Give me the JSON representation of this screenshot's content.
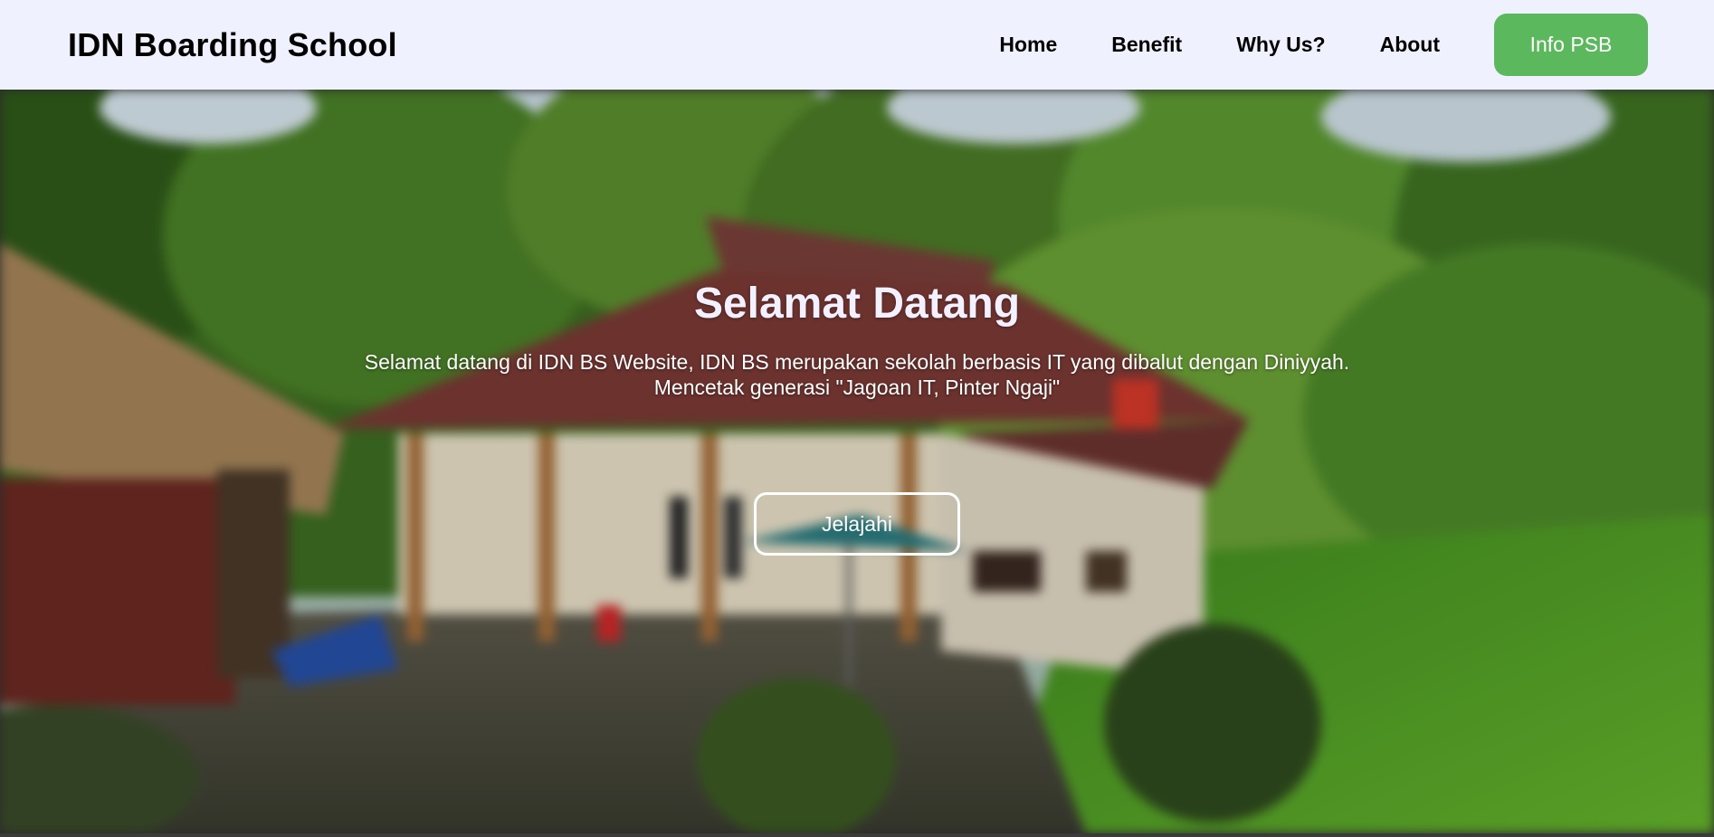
{
  "navbar": {
    "brand": "IDN Boarding School",
    "links": [
      "Home",
      "Benefit",
      "Why Us?",
      "About"
    ],
    "cta_label": "Info PSB"
  },
  "hero": {
    "title": "Selamat Datang",
    "text_line1": "Selamat datang di IDN BS Website, IDN BS merupakan sekolah berbasis IT yang dibalut dengan Diniyyah.",
    "text_line2": "Mencetak generasi \"Jagoan IT, Pinter Ngaji\"",
    "button_label": "Jelajahi"
  },
  "colors": {
    "navbar_bg": "#eff1ff",
    "cta_green": "#5cb85c"
  }
}
